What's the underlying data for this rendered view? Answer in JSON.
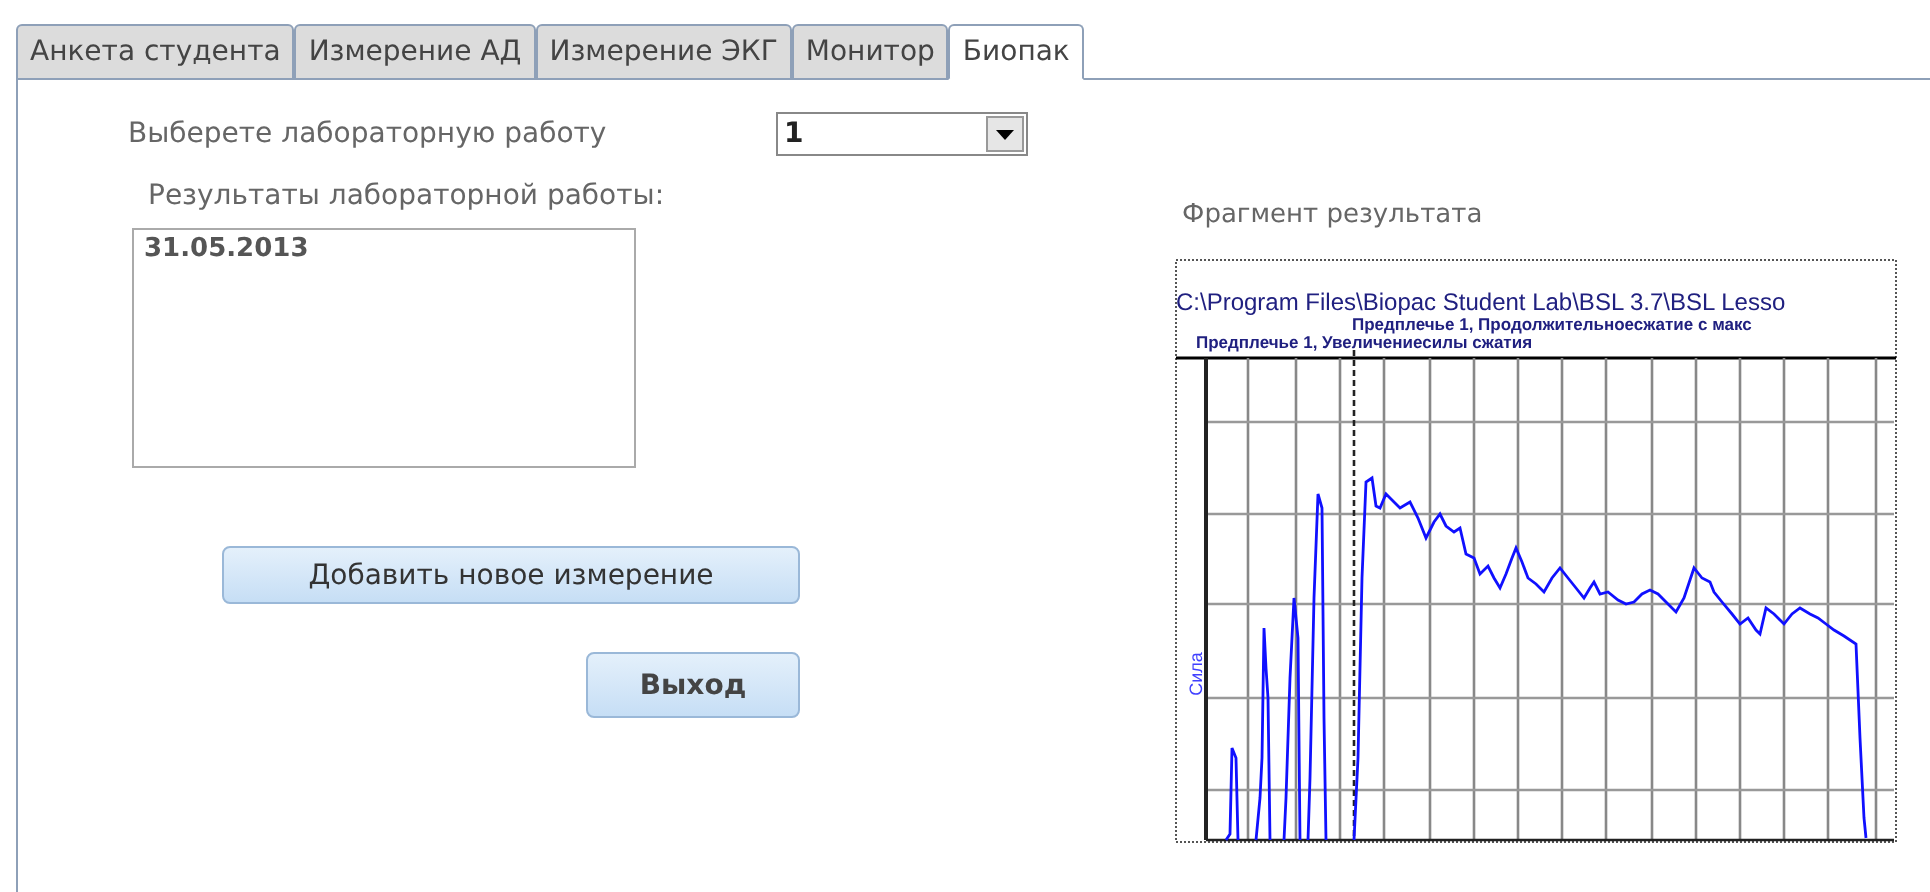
{
  "tabs": [
    {
      "label": "Анкета студента",
      "selected": false
    },
    {
      "label": "Измерение АД",
      "selected": false
    },
    {
      "label": "Измерение ЭКГ",
      "selected": false
    },
    {
      "label": "Монитор",
      "selected": false
    },
    {
      "label": "Биопак",
      "selected": true
    }
  ],
  "lab_select": {
    "label": "Выберете лабораторную работу",
    "value": "1"
  },
  "results": {
    "label": "Результаты лабораторной работы:",
    "items": [
      "31.05.2013"
    ]
  },
  "buttons": {
    "add": "Добавить новое измерение",
    "exit": "Выход"
  },
  "fragment": {
    "title": "Фрагмент результата",
    "file_path": "C:\\Program Files\\Biopac Student Lab\\BSL 3.7\\BSL Lesso",
    "marker_2": "Предплечье 1, Продолжительноесжатие с макс",
    "marker_1": "Предплечье 1, Увеличениесилы сжатия",
    "axis_label": "Сила"
  }
}
